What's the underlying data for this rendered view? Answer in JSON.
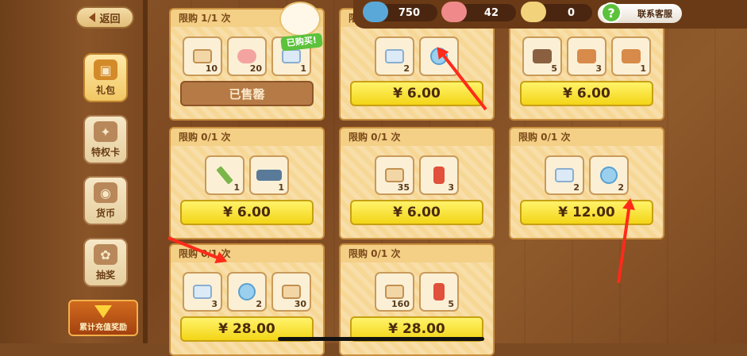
{
  "sidebar": {
    "back_label": "返回",
    "items": [
      {
        "label": "礼包",
        "icon": "gift-icon"
      },
      {
        "label": "特权卡",
        "icon": "privilege-card-icon"
      },
      {
        "label": "货币",
        "icon": "currency-icon"
      },
      {
        "label": "抽奖",
        "icon": "lottery-icon"
      }
    ],
    "reward_label": "累计充值奖励"
  },
  "topbar": {
    "currencies": [
      {
        "icon": "blue-fish-icon",
        "value": "750",
        "color": "#5aa8d8"
      },
      {
        "icon": "pink-fish-icon",
        "value": "42",
        "color": "#f08a8a"
      },
      {
        "icon": "ticket-icon",
        "value": "0",
        "color": "#f2d27a"
      }
    ],
    "service_label": "联系客服"
  },
  "badge": {
    "label": "已购买!"
  },
  "cards": [
    {
      "limit": "限购  1/1  次",
      "sold": "已售罄",
      "items": [
        {
          "g": "paw",
          "count": "10"
        },
        {
          "g": "fish",
          "count": "20"
        },
        {
          "g": "ticket",
          "count": "1"
        }
      ]
    },
    {
      "limit": "限购",
      "price": "¥  6.00",
      "items": [
        {
          "g": "ticket",
          "count": "2"
        },
        {
          "g": "coin",
          "count": ""
        }
      ]
    },
    {
      "limit": "",
      "price": "¥  6.00",
      "items": [
        {
          "g": "box",
          "count": "5"
        },
        {
          "g": "bento",
          "count": "3"
        },
        {
          "g": "bento",
          "count": "1"
        }
      ]
    },
    {
      "limit": "限购  0/1  次",
      "price": "¥  6.00",
      "items": [
        {
          "g": "pencil",
          "count": "1"
        },
        {
          "g": "card",
          "count": "1"
        }
      ]
    },
    {
      "limit": "限购  0/1  次",
      "price": "¥  6.00",
      "items": [
        {
          "g": "paw",
          "count": "35"
        },
        {
          "g": "bottle",
          "count": "3"
        }
      ]
    },
    {
      "limit": "限购  0/1  次",
      "price": "¥  12.00",
      "items": [
        {
          "g": "ticket",
          "count": "2"
        },
        {
          "g": "coin",
          "count": "2"
        }
      ]
    },
    {
      "limit": "限购  0/1  次",
      "price": "¥  28.00",
      "items": [
        {
          "g": "ticket",
          "count": "3"
        },
        {
          "g": "coin",
          "count": "2"
        },
        {
          "g": "paw",
          "count": "30"
        }
      ]
    },
    {
      "limit": "限购  0/1  次",
      "price": "¥  28.00",
      "items": [
        {
          "g": "paw",
          "count": "160"
        },
        {
          "g": "bottle",
          "count": "5"
        }
      ]
    }
  ]
}
